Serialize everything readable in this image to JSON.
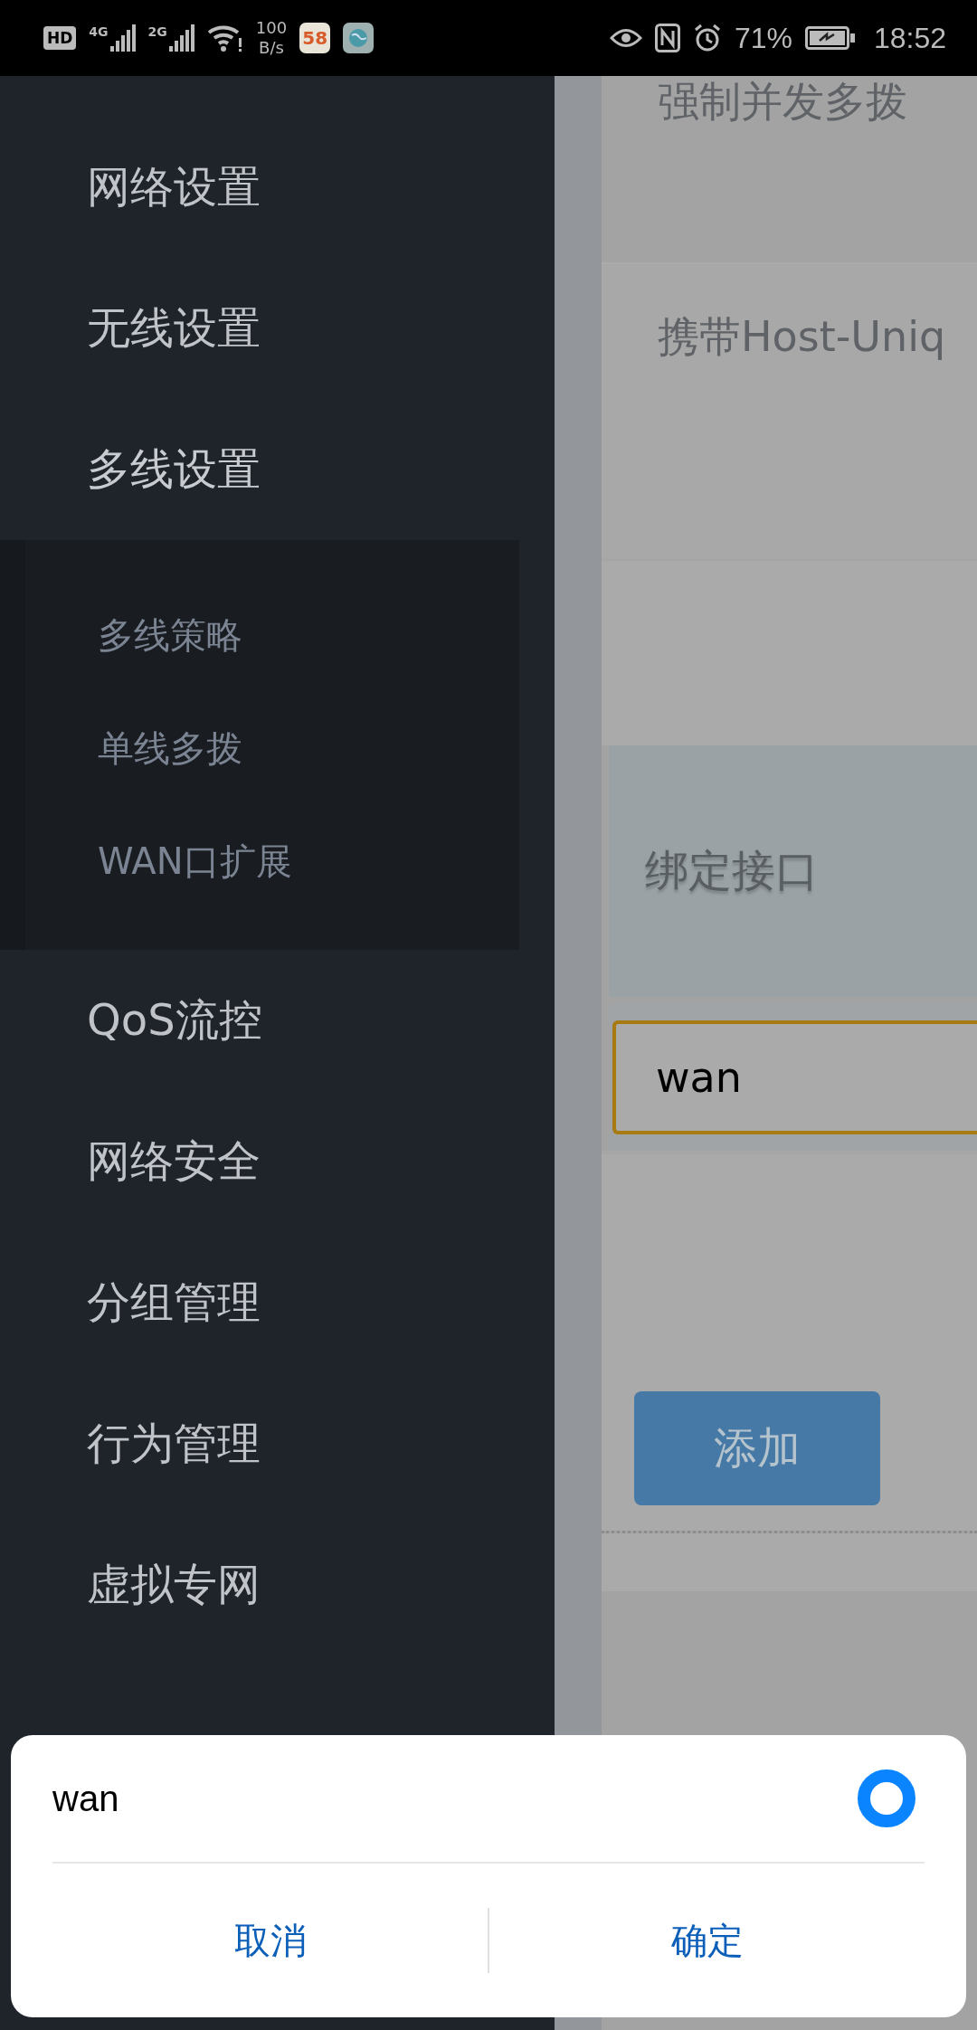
{
  "status_bar": {
    "hd_badge": "HD",
    "networks": [
      {
        "type": "4G"
      },
      {
        "type": "2G"
      }
    ],
    "speed_value": "100",
    "speed_unit": "B/s",
    "app_badge": "58",
    "battery_percent": "71%",
    "time": "18:52"
  },
  "sidebar": {
    "items": [
      {
        "label": "网络设置"
      },
      {
        "label": "无线设置"
      },
      {
        "label": "多线设置",
        "expanded": true,
        "children": [
          {
            "label": "多线策略"
          },
          {
            "label": "单线多拨"
          },
          {
            "label": "WAN口扩展"
          }
        ]
      },
      {
        "label": "QoS流控"
      },
      {
        "label": "网络安全"
      },
      {
        "label": "分组管理"
      },
      {
        "label": "行为管理"
      },
      {
        "label": "虚拟专网"
      }
    ]
  },
  "content": {
    "rows": [
      {
        "label": "强制并发多拨"
      },
      {
        "label": "携带Host-Uniq"
      }
    ],
    "bind_label": "绑定接口",
    "interface_field": {
      "value": "wan"
    },
    "add_button": "添加"
  },
  "dialog": {
    "options": [
      {
        "label": "wan",
        "selected": true
      }
    ],
    "buttons": [
      {
        "label": "取消"
      },
      {
        "label": "确定"
      }
    ]
  }
}
